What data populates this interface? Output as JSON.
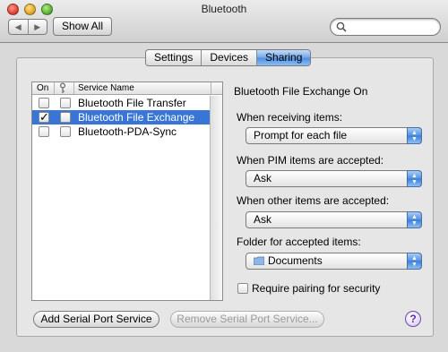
{
  "window": {
    "title": "Bluetooth"
  },
  "toolbar": {
    "back": "◀",
    "forward": "▶",
    "show_all": "Show All",
    "search_placeholder": ""
  },
  "tabs": [
    {
      "label": "Settings"
    },
    {
      "label": "Devices"
    },
    {
      "label": "Sharing",
      "active": true
    }
  ],
  "table": {
    "headers": {
      "on": "On",
      "name": "Service Name"
    },
    "rows": [
      {
        "label": "Bluetooth File Transfer",
        "on": false,
        "key": false,
        "selected": false
      },
      {
        "label": "Bluetooth File Exchange",
        "on": true,
        "key": false,
        "selected": true
      },
      {
        "label": "Bluetooth-PDA-Sync",
        "on": false,
        "key": false,
        "selected": false
      }
    ]
  },
  "detail": {
    "heading": "Bluetooth File Exchange On",
    "receiving_label": "When receiving items:",
    "receiving_value": "Prompt for each file",
    "pim_label": "When PIM items are accepted:",
    "pim_value": "Ask",
    "other_label": "When other items are accepted:",
    "other_value": "Ask",
    "folder_label": "Folder for accepted items:",
    "folder_value": "Documents",
    "require_pairing_label": "Require pairing for security",
    "require_pairing_checked": false
  },
  "buttons": {
    "add": "Add Serial Port Service",
    "remove": "Remove Serial Port Service...",
    "help": "?"
  },
  "colors": {
    "selection": "#3875d7",
    "accent": "#4d8ee0"
  }
}
